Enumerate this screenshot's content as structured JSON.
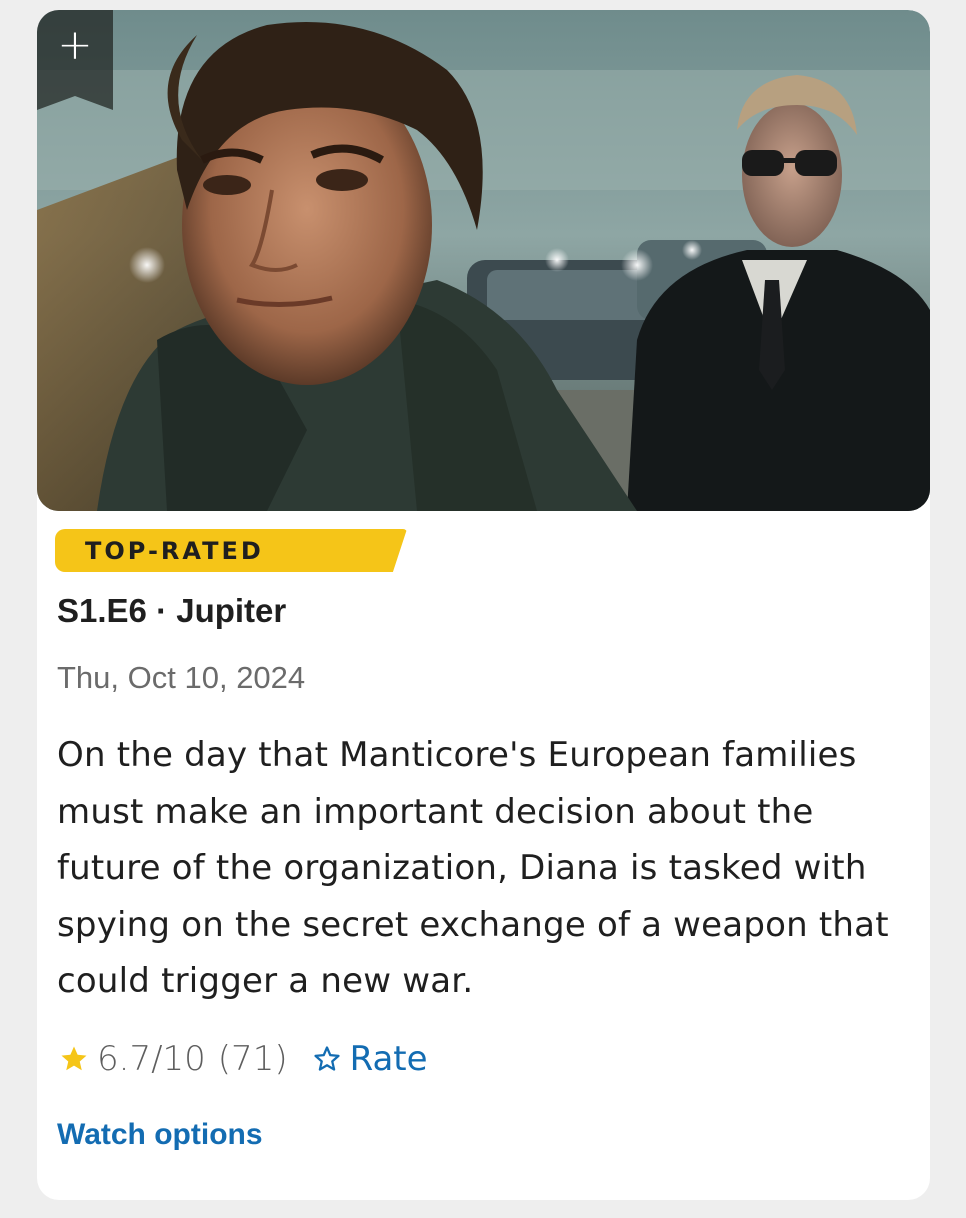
{
  "episode": {
    "badge": "TOP-RATED",
    "title": "S1.E6 · Jupiter",
    "air_date": "Thu, Oct 10, 2024",
    "plot": "On the day that Manticore's European families must make an important decision about the future of the organization, Diana is tasked with spying on the secret exchange of a weapon that could trigger a new war."
  },
  "watchlist": {
    "glyph": "+",
    "icon": "plus-icon"
  },
  "rating": {
    "value": "6.7/10",
    "count": "(71)",
    "star_icon": "star-filled-icon",
    "rate_label": "Rate",
    "rate_icon": "star-outline-icon"
  },
  "actions": {
    "watch_options": "Watch options"
  },
  "colors": {
    "badge": "#f5c518",
    "link": "#136cb2",
    "star": "#f5c518",
    "muted": "#6b6b6b"
  }
}
